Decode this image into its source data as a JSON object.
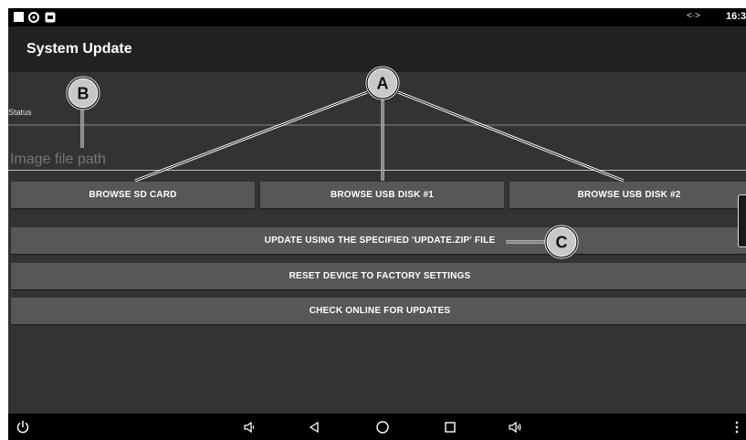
{
  "status_bar": {
    "time": "16:3",
    "net_glyph": "<·>",
    "icons": [
      "square-icon",
      "eye-icon",
      "app-icon"
    ]
  },
  "app_bar": {
    "title": "System Update"
  },
  "status": {
    "label": "Status"
  },
  "image_path": {
    "placeholder": "Image file path",
    "value": ""
  },
  "browse_buttons": [
    {
      "label": "BROWSE SD CARD"
    },
    {
      "label": "BROWSE USB DISK #1"
    },
    {
      "label": "BROWSE USB DISK #2"
    }
  ],
  "actions": {
    "update": "UPDATE USING THE SPECIFIED 'UPDATE.ZIP' FILE",
    "reset": "RESET DEVICE TO FACTORY SETTINGS",
    "check_online": "CHECK ONLINE FOR UPDATES"
  },
  "nav_bar": {
    "icons": [
      "power-icon",
      "volume-down-icon",
      "back-icon",
      "home-icon",
      "recents-icon",
      "volume-up-icon",
      "more-icon"
    ]
  },
  "callouts": {
    "a": "A",
    "b": "B",
    "c": "C"
  },
  "colors": {
    "screen_bg": "#333333",
    "app_bar_bg": "#212121",
    "button_bg": "#575757",
    "bars_bg": "#000000"
  }
}
